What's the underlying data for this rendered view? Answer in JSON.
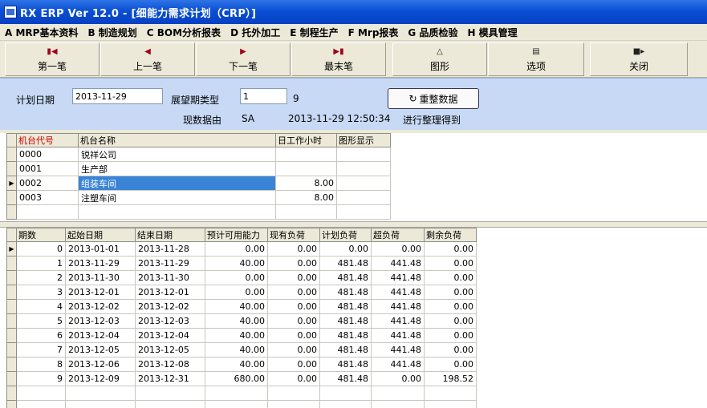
{
  "window": {
    "title": "RX ERP Ver 12.0 - [细能力需求计划（CRP）]"
  },
  "menu": [
    "A MRP基本资料",
    "B 制造规划",
    "C BOM分析报表",
    "D 托外加工",
    "E 制程生产",
    "F Mrp报表",
    "G 品质检验",
    "H 模具管理"
  ],
  "toolbar": {
    "first": "第一笔",
    "prev": "上一笔",
    "next": "下一笔",
    "last": "最末笔",
    "chart": "图形",
    "options": "选项",
    "close": "关闭"
  },
  "filter": {
    "plan_date_label": "计划日期",
    "plan_date_value": "2013-11-29",
    "horizon_type_label": "展望期类型",
    "horizon_type_value": "1",
    "horizon_type_extra": "9",
    "data_source_label": "现数据由",
    "data_source_user": "SA",
    "data_source_time": "2013-11-29 12:50:34",
    "data_source_suffix": "进行整理得到",
    "reorg_button": "重整数据"
  },
  "machines": {
    "columns": [
      "机台代号",
      "机台名称",
      "日工作小时",
      "图形显示"
    ],
    "rows": [
      {
        "code": "0000",
        "name": "锐祥公司",
        "hours": "",
        "chart": ""
      },
      {
        "code": "0001",
        "name": "生产部",
        "hours": "",
        "chart": ""
      },
      {
        "code": "0002",
        "name": "组装车间",
        "hours": "8.00",
        "chart": ""
      },
      {
        "code": "0003",
        "name": "注塑车间",
        "hours": "8.00",
        "chart": ""
      }
    ]
  },
  "periods": {
    "columns": [
      "期数",
      "起始日期",
      "结束日期",
      "预计可用能力",
      "现有负荷",
      "计划负荷",
      "超负荷",
      "剩余负荷"
    ],
    "rows": [
      [
        "0",
        "2013-01-01",
        "2013-11-28",
        "0.00",
        "0.00",
        "0.00",
        "0.00",
        "0.00"
      ],
      [
        "1",
        "2013-11-29",
        "2013-11-29",
        "40.00",
        "0.00",
        "481.48",
        "441.48",
        "0.00"
      ],
      [
        "2",
        "2013-11-30",
        "2013-11-30",
        "0.00",
        "0.00",
        "481.48",
        "441.48",
        "0.00"
      ],
      [
        "3",
        "2013-12-01",
        "2013-12-01",
        "0.00",
        "0.00",
        "481.48",
        "441.48",
        "0.00"
      ],
      [
        "4",
        "2013-12-02",
        "2013-12-02",
        "40.00",
        "0.00",
        "481.48",
        "441.48",
        "0.00"
      ],
      [
        "5",
        "2013-12-03",
        "2013-12-03",
        "40.00",
        "0.00",
        "481.48",
        "441.48",
        "0.00"
      ],
      [
        "6",
        "2013-12-04",
        "2013-12-04",
        "40.00",
        "0.00",
        "481.48",
        "441.48",
        "0.00"
      ],
      [
        "7",
        "2013-12-05",
        "2013-12-05",
        "40.00",
        "0.00",
        "481.48",
        "441.48",
        "0.00"
      ],
      [
        "8",
        "2013-12-06",
        "2013-12-08",
        "40.00",
        "0.00",
        "481.48",
        "441.48",
        "0.00"
      ],
      [
        "9",
        "2013-12-09",
        "2013-12-31",
        "680.00",
        "0.00",
        "481.48",
        "0.00",
        "198.52"
      ]
    ]
  }
}
